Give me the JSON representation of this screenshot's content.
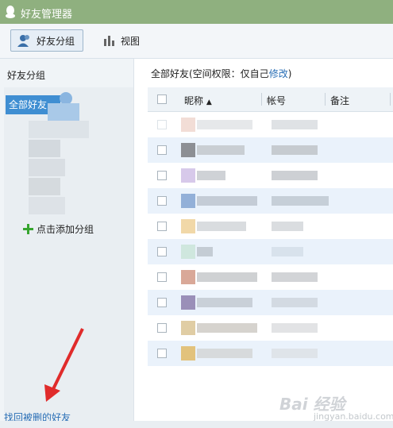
{
  "window": {
    "title": "好友管理器"
  },
  "toolbar": {
    "friend_group_label": "好友分组",
    "view_label": "视图"
  },
  "sidebar": {
    "heading": "好友分组",
    "selected_group": "全部好友",
    "add_group_label": "点击添加分组",
    "recover_link": "找回被删的好友"
  },
  "main": {
    "header_prefix": "全部好友(空间权限：仅自己",
    "header_link": "修改",
    "header_suffix": ")"
  },
  "table": {
    "columns": [
      "昵称",
      "帐号",
      "备注"
    ],
    "sort_indicator": "▲",
    "row_count": 10
  },
  "watermark": {
    "text": "Bai 经验",
    "sub": "jingyan.baidu.com"
  }
}
